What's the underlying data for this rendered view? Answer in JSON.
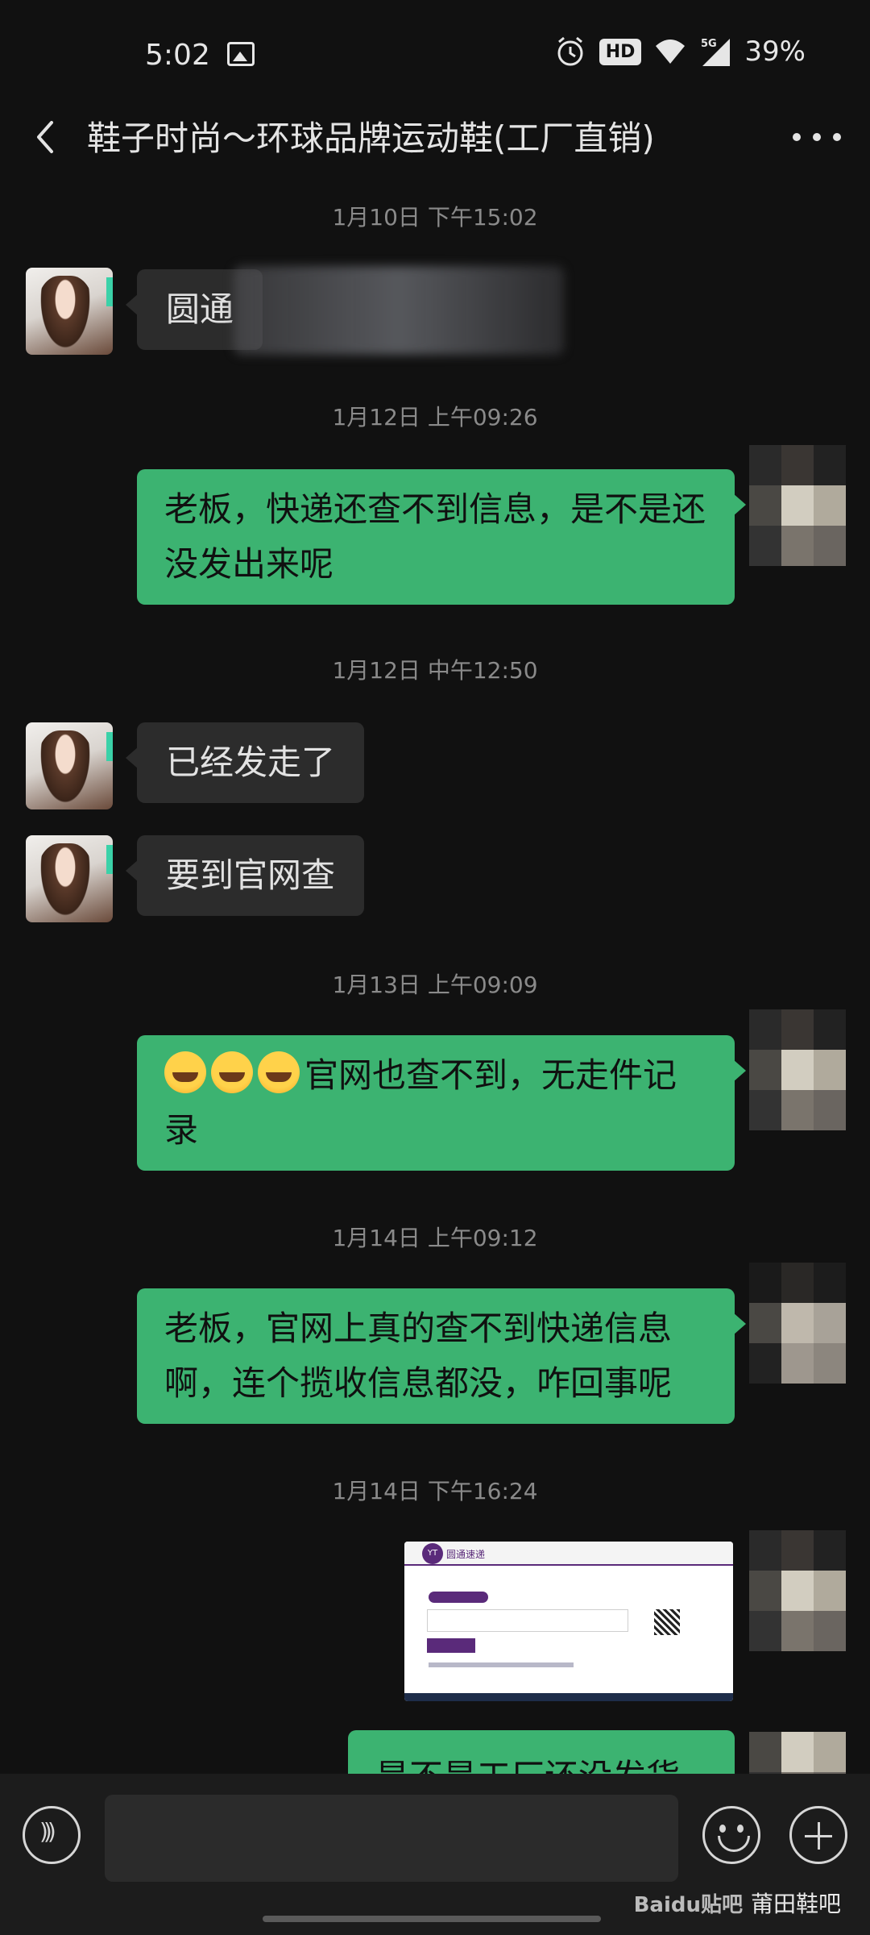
{
  "status_bar": {
    "time": "5:02",
    "hd": "HD",
    "network": "5G",
    "battery": "39%"
  },
  "header": {
    "title": "鞋子时尚～环球品牌运动鞋(工厂直销)"
  },
  "messages": {
    "ts1": "1月10日 下午15:02",
    "m1": "圆通",
    "ts2": "1月12日 上午09:26",
    "m2": "老板，快递还查不到信息，是不是还没发出来呢",
    "ts3": "1月12日 中午12:50",
    "m3": "已经发走了",
    "m4": "要到官网查",
    "ts4": "1月13日 上午09:09",
    "m5": "官网也查不到，无走件记录",
    "ts5": "1月14日 上午09:12",
    "m6": "老板，官网上真的查不到快递信息啊，连个揽收信息都没，咋回事呢",
    "ts6": "1月14日 下午16:24",
    "m7": "是不是工厂还没发货"
  },
  "screenshot_image": {
    "logo_text": "YT",
    "site_name": "圆通速递"
  },
  "input_bar": {
    "placeholder": ""
  },
  "watermark": {
    "brand": "Baidu贴吧",
    "forum": "莆田鞋吧"
  },
  "colors": {
    "background": "#111111",
    "bubble_self": "#3cb371",
    "bubble_other": "#2c2c2c",
    "accent_purple": "#5a2a7a"
  }
}
